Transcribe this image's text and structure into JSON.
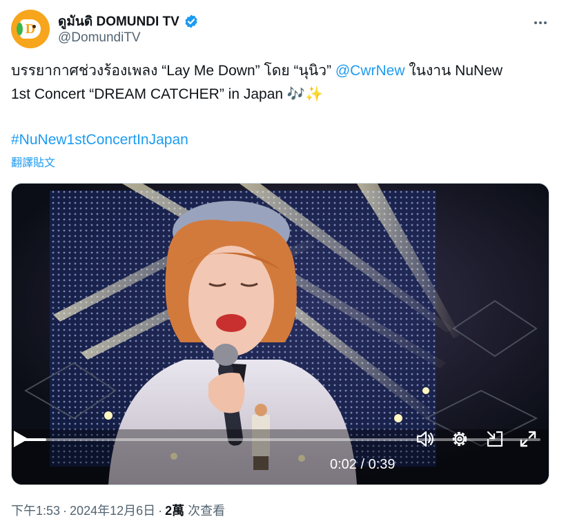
{
  "author": {
    "display_name": "ดูมันดิ DOMUNDI TV",
    "handle": "@DomundiTV",
    "avatar_color": "#f7a51c",
    "avatar_letter": "D",
    "verified": true
  },
  "tweet": {
    "text_line1_before": "บรรยากาศช่วงร้องเพลง “Lay Me Down” โดย “นุนิว” ",
    "mention": "@CwrNew",
    "text_line1_after": " ในงาน NuNew",
    "text_line2": "1st Concert “DREAM CATCHER” in Japan ",
    "emoji": "🎶✨",
    "hashtag": "#NuNew1stConcertInJapan",
    "translate_label": "翻譯貼文"
  },
  "video": {
    "elapsed": "0:02",
    "duration": "0:39",
    "time_separator": " / ",
    "progress_fraction": 0.05
  },
  "meta": {
    "time": "下午1:53",
    "date": "2024年12月6日",
    "views_count": "2萬",
    "views_label": " 次查看",
    "separator": "·"
  },
  "colors": {
    "link": "#1d9bf0",
    "secondary_text": "#536471",
    "verified": "#1d9bf0"
  },
  "icons": {
    "verified": "verified-badge-icon",
    "more": "more-icon",
    "play": "play-icon",
    "volume": "volume-icon",
    "settings": "settings-icon",
    "pip": "picture-in-picture-icon",
    "fullscreen": "fullscreen-icon"
  }
}
